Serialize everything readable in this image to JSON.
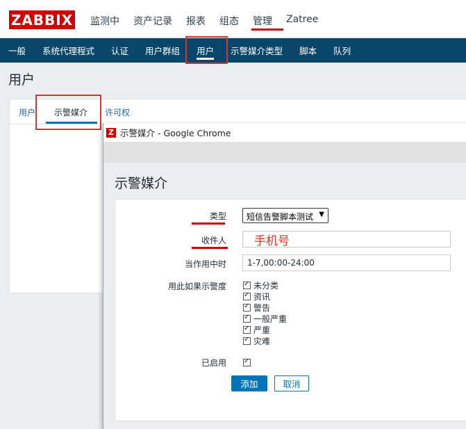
{
  "logo": "ZABBIX",
  "main_menu": [
    "监测中",
    "资产记录",
    "报表",
    "组态",
    "管理",
    "Zatree"
  ],
  "sub_menu": [
    "一般",
    "系统代理程式",
    "认证",
    "用户群组",
    "用户",
    "示警媒介类型",
    "脚本",
    "队列"
  ],
  "page_title": "用户",
  "tabs": [
    "用户",
    "示警媒介",
    "许可权"
  ],
  "popup": {
    "window_title": "示警媒介 - Google Chrome",
    "heading": "示警媒介",
    "type_label": "类型",
    "type_value": "短信告警脚本测试",
    "recipient_label": "收件人",
    "recipient_annotation": "手机号",
    "when_active_label": "当作用中时",
    "when_active_value": "1-7,00:00-24:00",
    "severity_label": "用此如果示警度",
    "severities": [
      "未分类",
      "资讯",
      "警告",
      "一般严重",
      "严重",
      "灾难"
    ],
    "enabled_label": "已启用",
    "add_button": "添加",
    "cancel_button": "取消"
  },
  "colors": {
    "brand": "#d40000",
    "nav": "#0a466a",
    "accent": "#0275b8",
    "highlight": "#d9342b"
  }
}
